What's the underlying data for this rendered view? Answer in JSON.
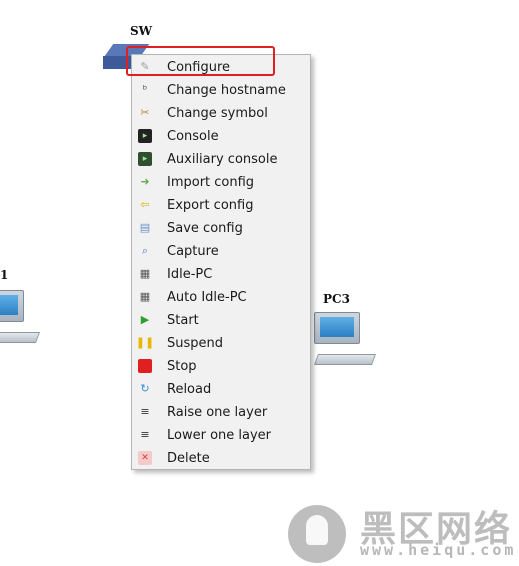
{
  "canvas": {
    "switch_label": "SW",
    "pc_left_label": "1",
    "pc_right_label": "PC3"
  },
  "menu": {
    "items": [
      {
        "label": "Configure",
        "icon": "wrench-icon",
        "color": "#9aa0a6"
      },
      {
        "label": "Change hostname",
        "icon": "hostname-icon",
        "color": "#555555"
      },
      {
        "label": "Change symbol",
        "icon": "scissors-icon",
        "color": "#b58a2a"
      },
      {
        "label": "Console",
        "icon": "console-icon",
        "color": "#222222"
      },
      {
        "label": "Auxiliary console",
        "icon": "aux-console-icon",
        "color": "#2f4f2f"
      },
      {
        "label": "Import config",
        "icon": "import-icon",
        "color": "#6aa84f"
      },
      {
        "label": "Export config",
        "icon": "export-icon",
        "color": "#e0b000"
      },
      {
        "label": "Save config",
        "icon": "save-icon",
        "color": "#6a8fc8"
      },
      {
        "label": "Capture",
        "icon": "magnifier-icon",
        "color": "#4a7fbf"
      },
      {
        "label": "Idle-PC",
        "icon": "calculator-icon",
        "color": "#555555"
      },
      {
        "label": "Auto Idle-PC",
        "icon": "calculator-icon",
        "color": "#555555"
      },
      {
        "label": "Start",
        "icon": "play-icon",
        "color": "#2e9e2e"
      },
      {
        "label": "Suspend",
        "icon": "pause-icon",
        "color": "#e6b800"
      },
      {
        "label": "Stop",
        "icon": "stop-icon",
        "color": "#e02020"
      },
      {
        "label": "Reload",
        "icon": "reload-icon",
        "color": "#3a8fd8"
      },
      {
        "label": "Raise one layer",
        "icon": "raise-layer-icon",
        "color": "#333333"
      },
      {
        "label": "Lower one layer",
        "icon": "lower-layer-icon",
        "color": "#333333"
      },
      {
        "label": "Delete",
        "icon": "delete-icon",
        "color": "#d04040"
      }
    ],
    "highlighted": "Configure"
  },
  "watermark": {
    "title": "黑区网络",
    "url": "www.heiqu.com"
  }
}
